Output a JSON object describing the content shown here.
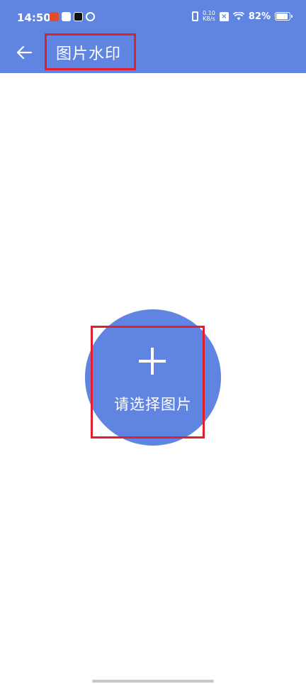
{
  "status_bar": {
    "time": "14:50",
    "net_speed_value": "0.10",
    "net_speed_unit": "KB/s",
    "battery": "82%"
  },
  "app_bar": {
    "title": "图片水印"
  },
  "main": {
    "select_label": "请选择图片"
  },
  "colors": {
    "primary": "#5f84e2",
    "highlight": "#e0202e"
  }
}
